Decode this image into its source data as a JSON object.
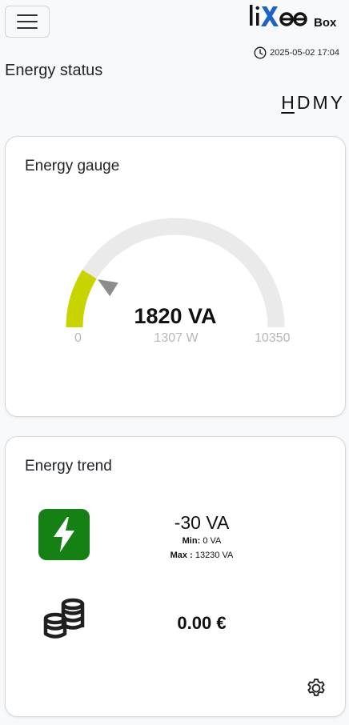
{
  "header": {
    "logo_text": "liXee",
    "logo_suffix": "Box",
    "datetime": "2025-05-02 17:04",
    "page_title": "Energy status",
    "period_tabs": [
      {
        "label": "H",
        "active": true
      },
      {
        "label": "D",
        "active": false
      },
      {
        "label": "M",
        "active": false
      },
      {
        "label": "Y",
        "active": false
      }
    ]
  },
  "gauge_card": {
    "title": "Energy gauge",
    "value_text": "1820 VA",
    "min_label": "0",
    "mid_label": "1307 W",
    "max_label": "10350",
    "level_fraction": 0.176,
    "fill_color": "#c8d400",
    "track_color": "#ebeaea"
  },
  "trend_card": {
    "title": "Energy trend",
    "power_value": "-30 VA",
    "min_label": "Min:",
    "min_value": "0 VA",
    "max_label": "Max :",
    "max_value": "13230 VA",
    "cost_value": "0.00 €",
    "power_icon": "lightning-icon",
    "power_icon_bg": "#158014",
    "cost_icon": "coins-icon",
    "settings_icon": "gear-icon"
  }
}
